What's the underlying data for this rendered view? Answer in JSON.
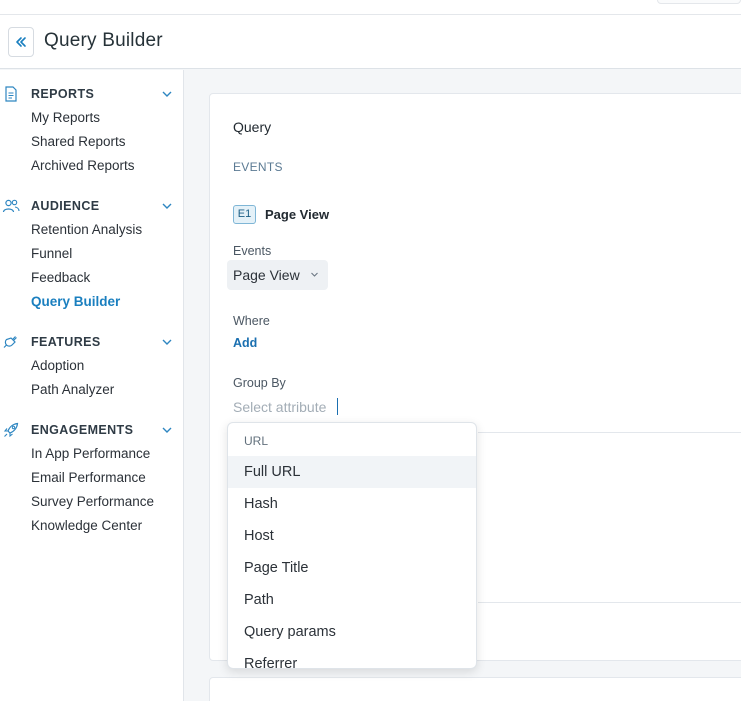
{
  "header": {
    "title": "Query Builder"
  },
  "sidebar": {
    "sections": [
      {
        "title": "REPORTS",
        "icon": "document-icon",
        "items": [
          "My Reports",
          "Shared Reports",
          "Archived Reports"
        ]
      },
      {
        "title": "AUDIENCE",
        "icon": "users-icon",
        "items": [
          "Retention Analysis",
          "Funnel",
          "Feedback",
          "Query Builder"
        ]
      },
      {
        "title": "FEATURES",
        "icon": "plug-icon",
        "items": [
          "Adoption",
          "Path Analyzer"
        ]
      },
      {
        "title": "ENGAGEMENTS",
        "icon": "rocket-icon",
        "items": [
          "In App Performance",
          "Email Performance",
          "Survey Performance",
          "Knowledge Center"
        ]
      }
    ],
    "active_item": "Query Builder"
  },
  "query": {
    "title": "Query",
    "events_heading": "EVENTS",
    "event_badge": "E1",
    "event_name": "Page View",
    "events_label": "Events",
    "events_value": "Page View",
    "where_label": "Where",
    "where_add": "Add",
    "group_by_label": "Group By",
    "group_by_placeholder": "Select attribute"
  },
  "dropdown": {
    "group": "URL",
    "items": [
      "Full URL",
      "Hash",
      "Host",
      "Page Title",
      "Path",
      "Query params",
      "Referrer"
    ],
    "highlighted": "Full URL"
  },
  "colors": {
    "accent": "#1a7fbf",
    "link": "#1a6fb0"
  }
}
